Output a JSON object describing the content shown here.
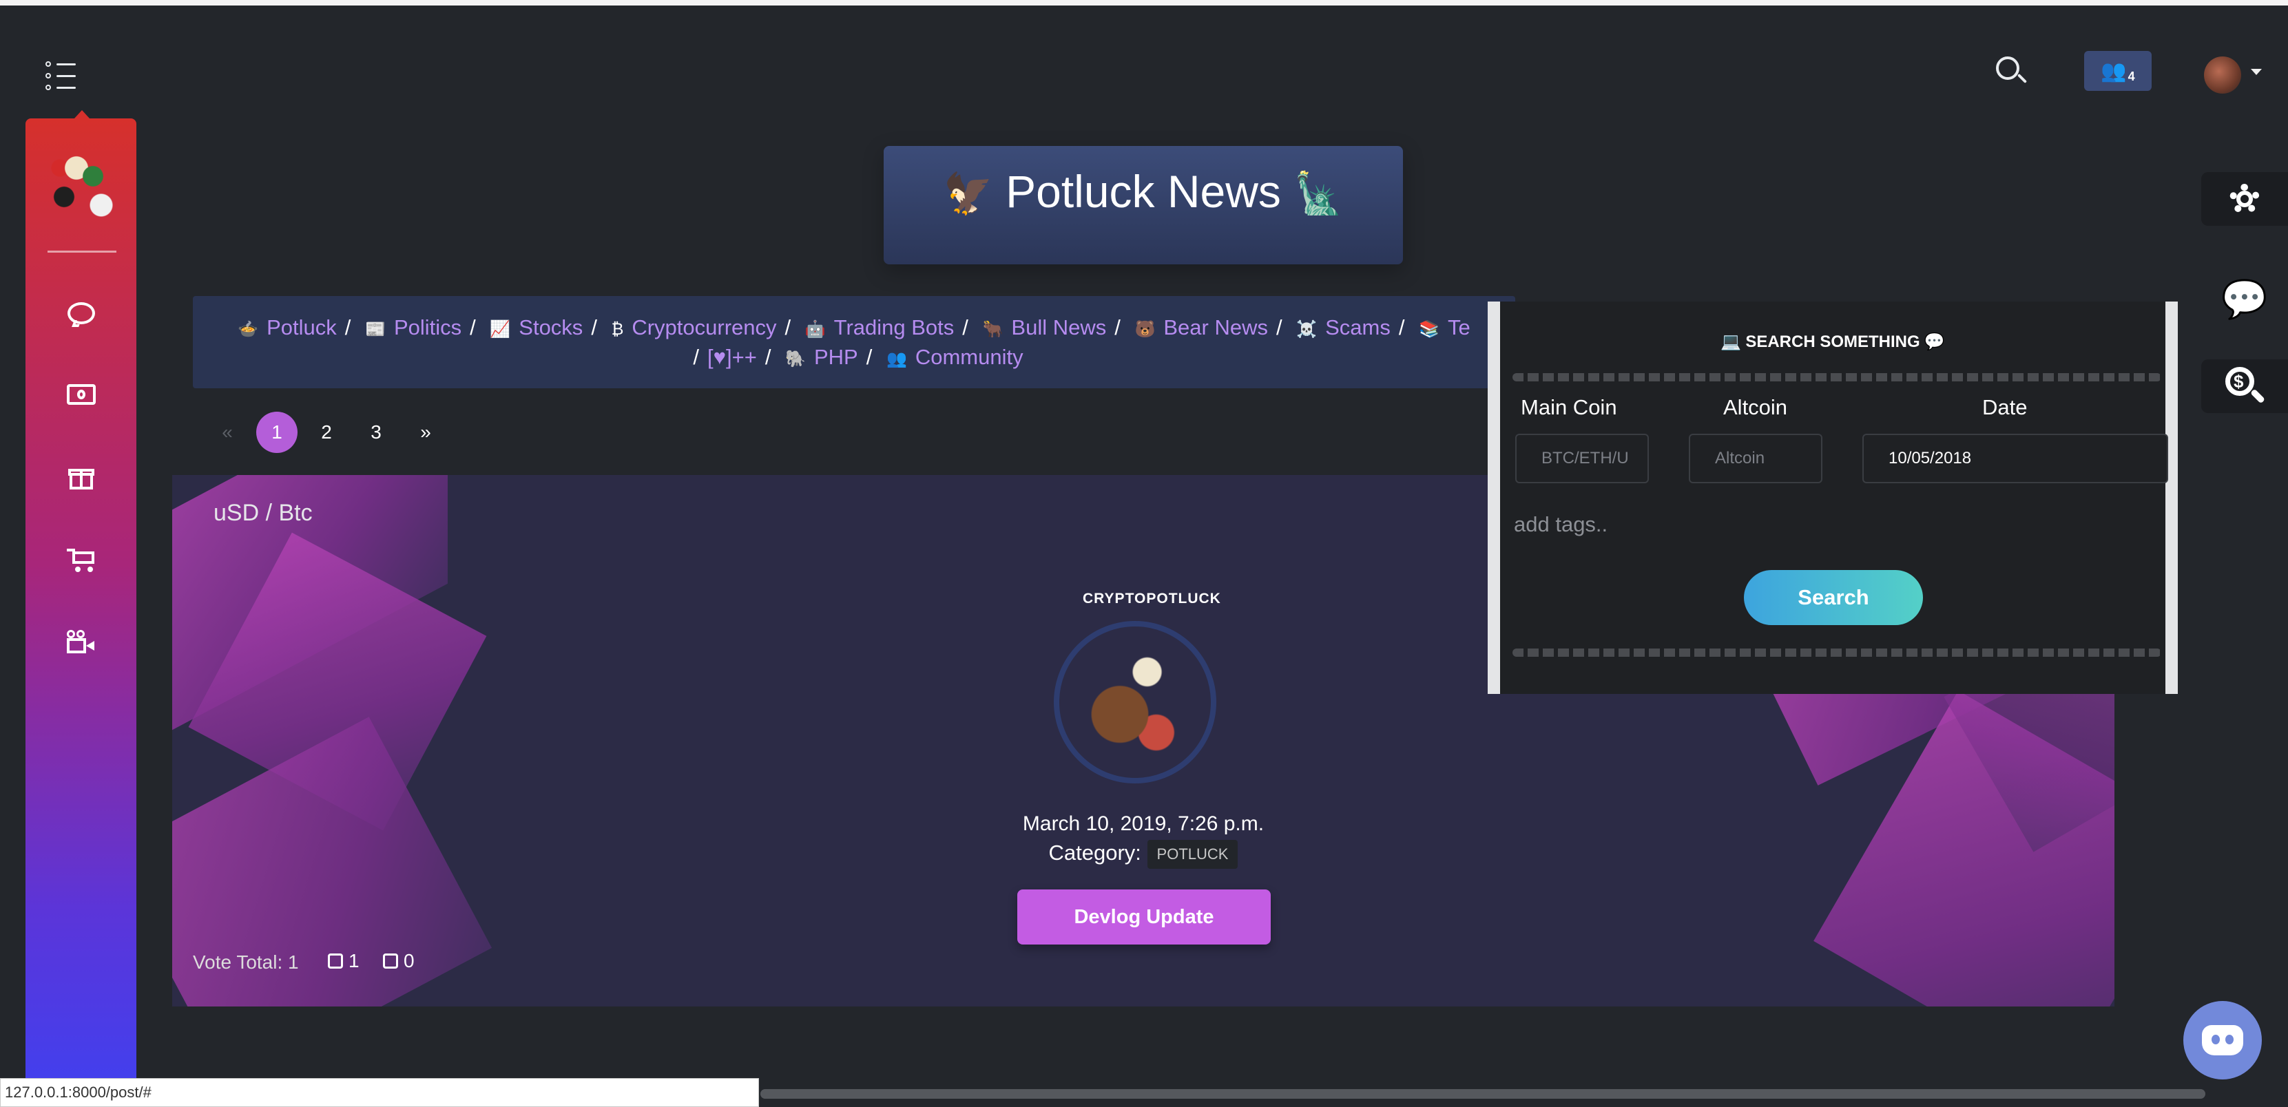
{
  "header": {
    "site_title": "Potluck News",
    "title_emoji_left": "🦅",
    "title_emoji_right": "🗽",
    "users_badge": "4"
  },
  "sidebar": {
    "items": [
      {
        "icon": "chat-icon"
      },
      {
        "icon": "money-icon"
      },
      {
        "icon": "gift-icon"
      },
      {
        "icon": "cart-icon"
      },
      {
        "icon": "video-icon"
      }
    ]
  },
  "categories": {
    "line1": [
      {
        "emoji": "🍲",
        "label": "Potluck"
      },
      {
        "emoji": "📰",
        "label": "Politics"
      },
      {
        "emoji": "📈",
        "label": "Stocks"
      },
      {
        "emoji": "₿",
        "label": "Cryptocurrency"
      },
      {
        "emoji": "🤖",
        "label": "Trading Bots"
      },
      {
        "emoji": "🐂",
        "label": "Bull News"
      },
      {
        "emoji": "🐻",
        "label": "Bear News"
      },
      {
        "emoji": "☠️",
        "label": "Scams"
      },
      {
        "emoji": "📚",
        "label": "Te"
      }
    ],
    "line2": [
      {
        "emoji": "",
        "label": "[♥]++"
      },
      {
        "emoji": "🐘",
        "label": "PHP"
      },
      {
        "emoji": "👥",
        "label": "Community"
      }
    ]
  },
  "pagination": {
    "prev": "«",
    "pages": [
      "1",
      "2",
      "3"
    ],
    "active": "1",
    "next": "»"
  },
  "post": {
    "pair": "uSD / Btc",
    "author": "CRYPTOPOTLUCK",
    "date": "March 10, 2019, 7:26 p.m.",
    "category_label": "Category:",
    "category_value": "POTLUCK",
    "title_button": "Devlog Update",
    "vote_total": "Vote Total: 1",
    "upvotes": "1",
    "downvotes": "0"
  },
  "search_panel": {
    "title": "SEARCH SOMETHING",
    "main_coin_label": "Main Coin",
    "altcoin_label": "Altcoin",
    "date_label": "Date",
    "main_coin_placeholder": "BTC/ETH/U",
    "altcoin_placeholder": "Altcoin",
    "date_value": "10/05/2018",
    "tags_placeholder": "add tags..",
    "search_button": "Search"
  },
  "status_bar": {
    "url": "127.0.0.1:8000/post/#"
  }
}
